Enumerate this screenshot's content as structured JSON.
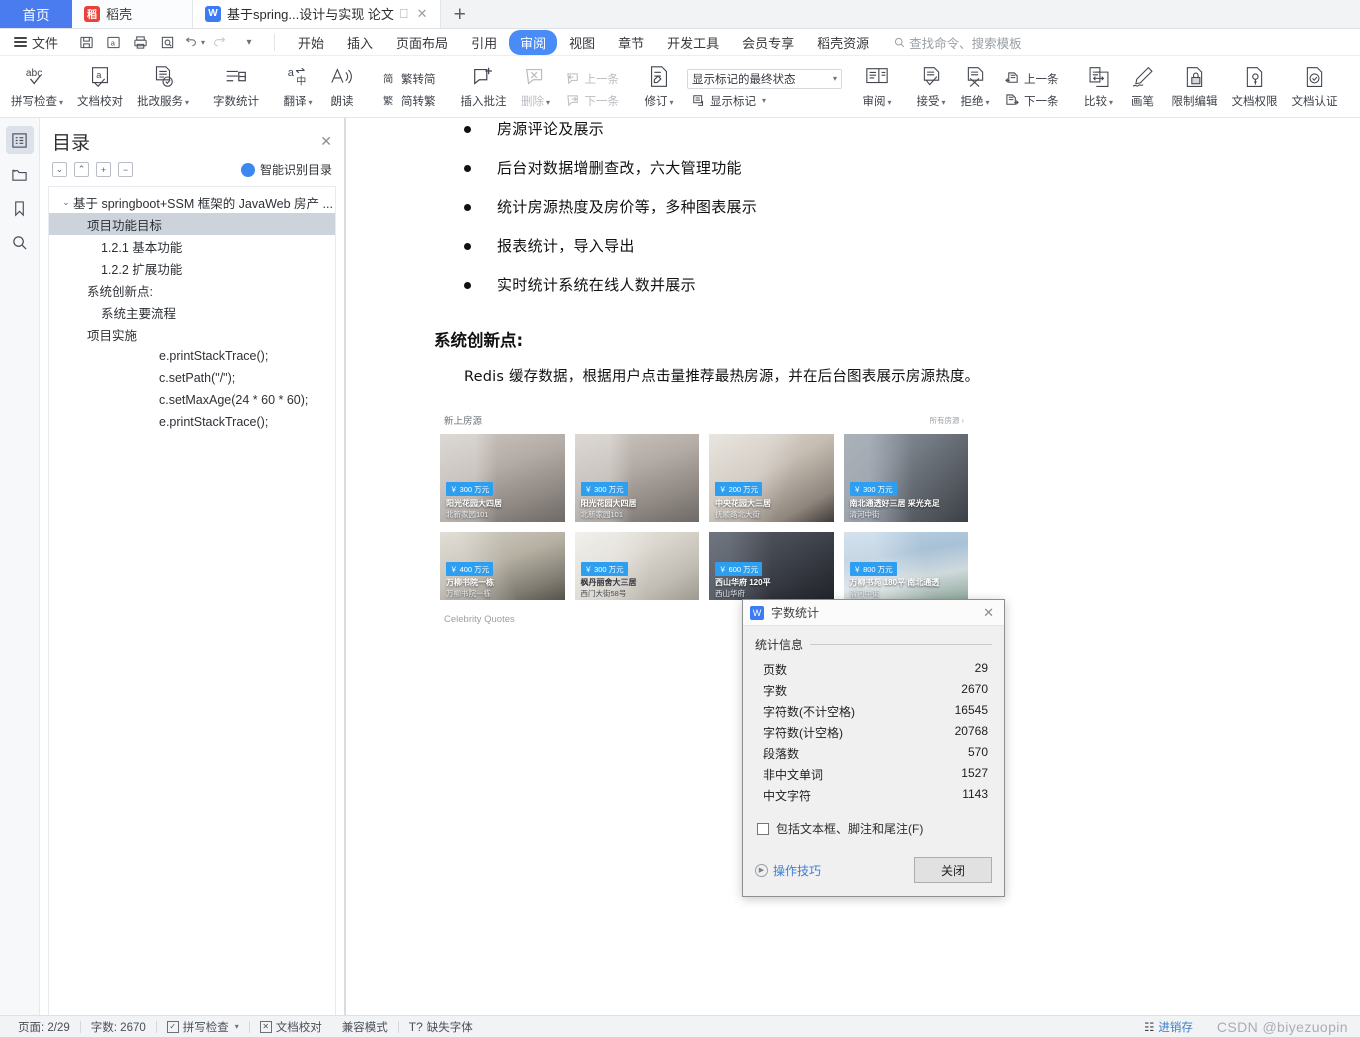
{
  "tabbar": {
    "home_label": "首页",
    "tab2_label": "稻壳",
    "tab2_icon": "wps-docer-icon",
    "doc_label": "基于spring...设计与实现 论文",
    "doc_icon": "wps-writer-icon",
    "cast_icon": "screen-cast-icon",
    "close_icon": "close-icon",
    "new_tab_icon": "plus-icon"
  },
  "menubar": {
    "file_label": "文件",
    "quick_icons": [
      "save-icon",
      "save-as-icon",
      "print-icon",
      "print-preview-icon",
      "undo-icon",
      "redo-icon",
      "customize-icon"
    ],
    "tabs": [
      {
        "label": "开始",
        "active": false
      },
      {
        "label": "插入",
        "active": false
      },
      {
        "label": "页面布局",
        "active": false
      },
      {
        "label": "引用",
        "active": false
      },
      {
        "label": "审阅",
        "active": true
      },
      {
        "label": "视图",
        "active": false
      },
      {
        "label": "章节",
        "active": false
      },
      {
        "label": "开发工具",
        "active": false
      },
      {
        "label": "会员专享",
        "active": false
      },
      {
        "label": "稻壳资源",
        "active": false
      }
    ],
    "search_placeholder": "查找命令、搜索模板",
    "search_icon": "search-icon"
  },
  "ribbon": {
    "groups": [
      {
        "items": [
          {
            "label": "拼写检查",
            "icon": "spell-check-icon",
            "dropdown": true,
            "disabled": false
          },
          {
            "label": "文档校对",
            "icon": "proofread-icon",
            "dropdown": false,
            "disabled": false
          },
          {
            "label": "批改服务",
            "icon": "correction-service-icon",
            "dropdown": true,
            "disabled": false
          }
        ]
      },
      {
        "items": [
          {
            "label": "字数统计",
            "icon": "word-count-icon",
            "dropdown": false,
            "disabled": false
          }
        ]
      },
      {
        "items": [
          {
            "label": "翻译",
            "icon": "translate-icon",
            "dropdown": true,
            "disabled": false
          },
          {
            "label": "朗读",
            "icon": "read-aloud-icon",
            "dropdown": false,
            "disabled": false
          }
        ]
      },
      {
        "stack": [
          {
            "label": "繁转简",
            "icon": "trad-to-simp-icon"
          },
          {
            "label": "简转繁",
            "icon": "simp-to-trad-icon"
          }
        ]
      },
      {
        "items": [
          {
            "label": "插入批注",
            "icon": "insert-comment-icon",
            "dropdown": false,
            "disabled": false
          },
          {
            "label": "删除",
            "icon": "delete-comment-icon",
            "dropdown": true,
            "disabled": true
          }
        ],
        "stack": [
          {
            "label": "上一条",
            "icon": "previous-comment-icon",
            "disabled": true
          },
          {
            "label": "下一条",
            "icon": "next-comment-icon",
            "disabled": true
          }
        ]
      },
      {
        "items": [
          {
            "label": "修订",
            "icon": "track-changes-icon",
            "dropdown": true,
            "disabled": false
          }
        ],
        "combo": {
          "value": "显示标记的最终状态",
          "name": "markup-display-select"
        },
        "stack": [
          {
            "label": "显示标记",
            "icon": "show-markup-icon",
            "dropdown": true
          }
        ]
      },
      {
        "items": [
          {
            "label": "审阅",
            "icon": "reviewing-pane-icon",
            "dropdown": true,
            "disabled": false
          }
        ]
      },
      {
        "items": [
          {
            "label": "接受",
            "icon": "accept-change-icon",
            "dropdown": true,
            "disabled": false
          },
          {
            "label": "拒绝",
            "icon": "reject-change-icon",
            "dropdown": true,
            "disabled": false
          }
        ],
        "stack": [
          {
            "label": "上一条",
            "icon": "previous-change-icon"
          },
          {
            "label": "下一条",
            "icon": "next-change-icon"
          }
        ]
      },
      {
        "items": [
          {
            "label": "比较",
            "icon": "compare-icon",
            "dropdown": true,
            "disabled": false
          },
          {
            "label": "画笔",
            "icon": "pen-icon",
            "dropdown": false,
            "disabled": false
          },
          {
            "label": "限制编辑",
            "icon": "restrict-edit-icon",
            "dropdown": false,
            "disabled": false
          },
          {
            "label": "文档权限",
            "icon": "doc-permission-icon",
            "dropdown": false,
            "disabled": false
          },
          {
            "label": "文档认证",
            "icon": "doc-certify-icon",
            "dropdown": false,
            "disabled": false
          }
        ]
      }
    ]
  },
  "iconbar": [
    {
      "name": "outline-panel-icon",
      "selected": true
    },
    {
      "name": "thumbnail-panel-icon",
      "selected": false
    },
    {
      "name": "bookmark-panel-icon",
      "selected": false
    },
    {
      "name": "search-panel-icon",
      "selected": false
    }
  ],
  "outline": {
    "title": "目录",
    "close_icon": "close-icon",
    "tools": [
      {
        "name": "expand-down-button",
        "glyph": "⌄"
      },
      {
        "name": "collapse-up-button",
        "glyph": "⌃"
      },
      {
        "name": "expand-all-button",
        "glyph": "+"
      },
      {
        "name": "collapse-all-button",
        "glyph": "−"
      }
    ],
    "smart_label": "智能识别目录",
    "items": [
      {
        "label": "基于 springboot+SSM 框架的 JavaWeb 房产 ...",
        "indent": 0,
        "chevron": true,
        "selected": false,
        "mono": false
      },
      {
        "label": "项目功能目标",
        "indent": 1,
        "chevron": false,
        "selected": true,
        "mono": false
      },
      {
        "label": "1.2.1  基本功能",
        "indent": 2,
        "chevron": false,
        "selected": false,
        "mono": false
      },
      {
        "label": "1.2.2  扩展功能",
        "indent": 2,
        "chevron": false,
        "selected": false,
        "mono": false
      },
      {
        "label": "系统创新点:",
        "indent": 1,
        "chevron": false,
        "selected": false,
        "mono": false
      },
      {
        "label": "系统主要流程",
        "indent": 2,
        "chevron": false,
        "selected": false,
        "mono": false
      },
      {
        "label": "项目实施",
        "indent": 1,
        "chevron": false,
        "selected": false,
        "mono": false
      },
      {
        "label": "e.printStackTrace();",
        "indent": 5,
        "chevron": false,
        "selected": false,
        "mono": true
      },
      {
        "label": "c.setPath(\"/\");",
        "indent": 5,
        "chevron": false,
        "selected": false,
        "mono": true
      },
      {
        "label": "c.setMaxAge(24 * 60 * 60);",
        "indent": 5,
        "chevron": false,
        "selected": false,
        "mono": true
      },
      {
        "label": "e.printStackTrace();",
        "indent": 5,
        "chevron": false,
        "selected": false,
        "mono": true
      }
    ]
  },
  "document": {
    "bullets": [
      "房源评论及展示",
      "后台对数据增删查改，六大管理功能",
      "统计房源热度及房价等，多种图表展示",
      "报表统计，导入导出",
      "实时统计系统在线人数并展示"
    ],
    "heading": "系统创新点:",
    "paragraph": "Redis 缓存数据，根据用户点击量推荐最热房源，并在后台图表展示房源热度。",
    "screenshot": {
      "section_title": "新上房源",
      "more_label": "所有房源",
      "more_icon": "chevron-right-icon",
      "footer_label": "Celebrity Quotes",
      "cards": [
        {
          "price": "￥ 300 万元",
          "title": "阳光花园大四居",
          "sub": "北新家园101",
          "tone": "#b9b2ad"
        },
        {
          "price": "￥ 300 万元",
          "title": "阳光花园大四居",
          "sub": "北新家园101",
          "tone": "#b9b2ad"
        },
        {
          "price": "￥ 200 万元",
          "title": "中央花园大三居",
          "sub": "抚顺路北大街",
          "tone": "#bcb5ae"
        },
        {
          "price": "￥ 300 万元",
          "title": "南北通透好三居 采光充足",
          "sub": "清河中街",
          "tone": "#8e9399"
        },
        {
          "price": "￥ 400 万元",
          "title": "万柳书院一栋",
          "sub": "万柳书院一栋",
          "tone": "#a9a59c"
        },
        {
          "price": "￥ 300 万元",
          "title": "枫丹丽舍大三居",
          "sub": "西门大街58号",
          "tone": "#d6d3cd"
        },
        {
          "price": "￥ 600 万元",
          "title": "西山华府 120平",
          "sub": "西山华府",
          "tone": "#4b4e57"
        },
        {
          "price": "￥ 800 万元",
          "title": "万柳书苑 180平 南北通透",
          "sub": "清河中街",
          "tone": "#9fb6c8"
        }
      ]
    }
  },
  "dialog": {
    "title": "字数统计",
    "icon": "wps-writer-icon",
    "close_icon": "close-icon",
    "group_label": "统计信息",
    "stats": [
      {
        "label": "页数",
        "value": "29"
      },
      {
        "label": "字数",
        "value": "2670"
      },
      {
        "label": "字符数(不计空格)",
        "value": "16545"
      },
      {
        "label": "字符数(计空格)",
        "value": "20768"
      },
      {
        "label": "段落数",
        "value": "570"
      },
      {
        "label": "非中文单词",
        "value": "1527"
      },
      {
        "label": "中文字符",
        "value": "1143"
      }
    ],
    "checkbox_label": "包括文本框、脚注和尾注(F)",
    "checkbox_checked": false,
    "tips_label": "操作技巧",
    "tips_icon": "play-circle-icon",
    "close_button": "关闭"
  },
  "status": {
    "page_label": "页面: 2/29",
    "word_label": "字数: 2670",
    "spell_label": "拼写检查",
    "spell_icon": "check-box-icon",
    "proof_label": "文档校对",
    "proof_icon": "x-box-icon",
    "compat_label": "兼容模式",
    "font_label": "缺失字体",
    "font_icon": "font-missing-icon",
    "erp_label": "进销存",
    "erp_icon": "erp-icon",
    "watermark": "CSDN @biyezuopin"
  }
}
